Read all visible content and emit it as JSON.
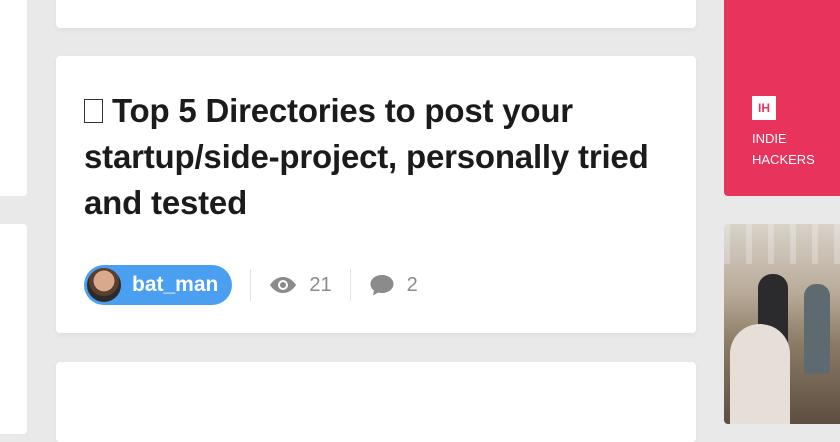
{
  "post": {
    "title": "Top 5 Directories to post your startup/side-project, personally tried and tested",
    "title_icon": "unrendered-emoji-box",
    "author": "bat_man",
    "views": "21",
    "comments": "2"
  },
  "sidebar_ad": {
    "logo_text": "IH",
    "brand_line1": "INDIE",
    "brand_line2": "HACKERS"
  },
  "colors": {
    "author_pill": "#4a9ff0",
    "ad_background": "#e8335c",
    "page_background": "#e9e9e9",
    "card_background": "#ffffff"
  }
}
